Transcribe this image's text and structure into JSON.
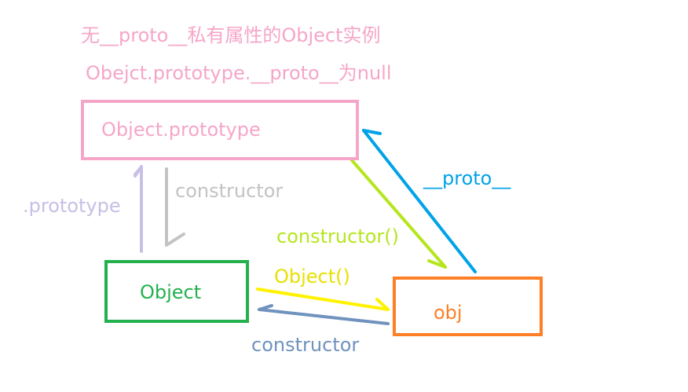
{
  "notes": {
    "line1": "无__proto__私有属性的Object实例",
    "line2": "Obejct.prototype.__proto__为null"
  },
  "nodes": {
    "object_prototype": "Object.prototype",
    "object": "Object",
    "obj": "obj"
  },
  "edges": {
    "prototype": ".prototype",
    "constructor_gray": "constructor",
    "proto": "__proto__",
    "constructor_call": "constructor()",
    "object_call": "Object()",
    "constructor_blue": "constructor"
  },
  "colors": {
    "pink": "#f5a6c8",
    "green": "#22b14c",
    "orange": "#ff7f27",
    "lavender": "#c8bfe7",
    "gray": "#c3c3c3",
    "sky": "#00a2e8",
    "lime": "#b5e61d",
    "yellow": "#fff200",
    "steel": "#7092be"
  }
}
